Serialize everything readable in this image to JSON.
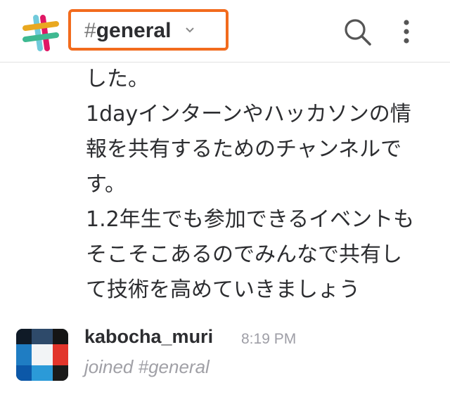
{
  "header": {
    "channel_hash": "#",
    "channel_name": "general",
    "icons": {
      "logo": "slack-logo",
      "dropdown": "chevron-down-icon",
      "search": "search-icon",
      "more": "more-vertical-icon"
    },
    "highlight_color": "#f26b1d"
  },
  "message": {
    "lines": [
      "した。",
      "1dayインターンやハッカソンの情",
      "報を共有するためのチャンネルで",
      "す。",
      "1.2年生でも参加できるイベントも",
      "そこそこあるのでみんなで共有し",
      "て技術を高めていきましょう"
    ]
  },
  "post": {
    "author": "kabocha_muri",
    "time": "8:19 PM",
    "text": "joined #general"
  }
}
